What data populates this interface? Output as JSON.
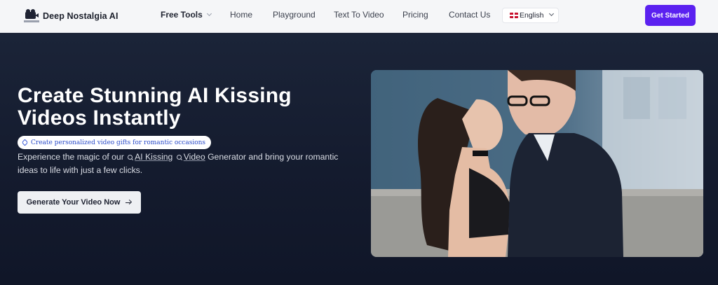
{
  "brand": {
    "name": "Deep Nostalgia AI",
    "logo_icon": "camera-logo-icon"
  },
  "nav": {
    "free_tools": "Free Tools",
    "home": "Home",
    "playground": "Playground",
    "text_to_video": "Text To Video",
    "pricing": "Pricing",
    "contact": "Contact Us",
    "language": "English",
    "get_started": "Get Started"
  },
  "hero": {
    "title_line1": "Create Stunning AI Kissing",
    "title_line2": "Videos Instantly",
    "chip": "Create personalized video gifts for romantic occasions",
    "desc_before": "Experience the magic of our",
    "desc_kw1": "AI Kissing",
    "desc_kw2": "Video",
    "desc_after": " Generator and bring your romantic",
    "desc_line2": "ideas to life with just a few clicks.",
    "cta": "Generate Your Video Now"
  },
  "colors": {
    "accent": "#5b21f0",
    "hero_bg": "#141b2e",
    "nav_bg": "#f5f6f8",
    "chip_text": "#2a4bc8"
  }
}
